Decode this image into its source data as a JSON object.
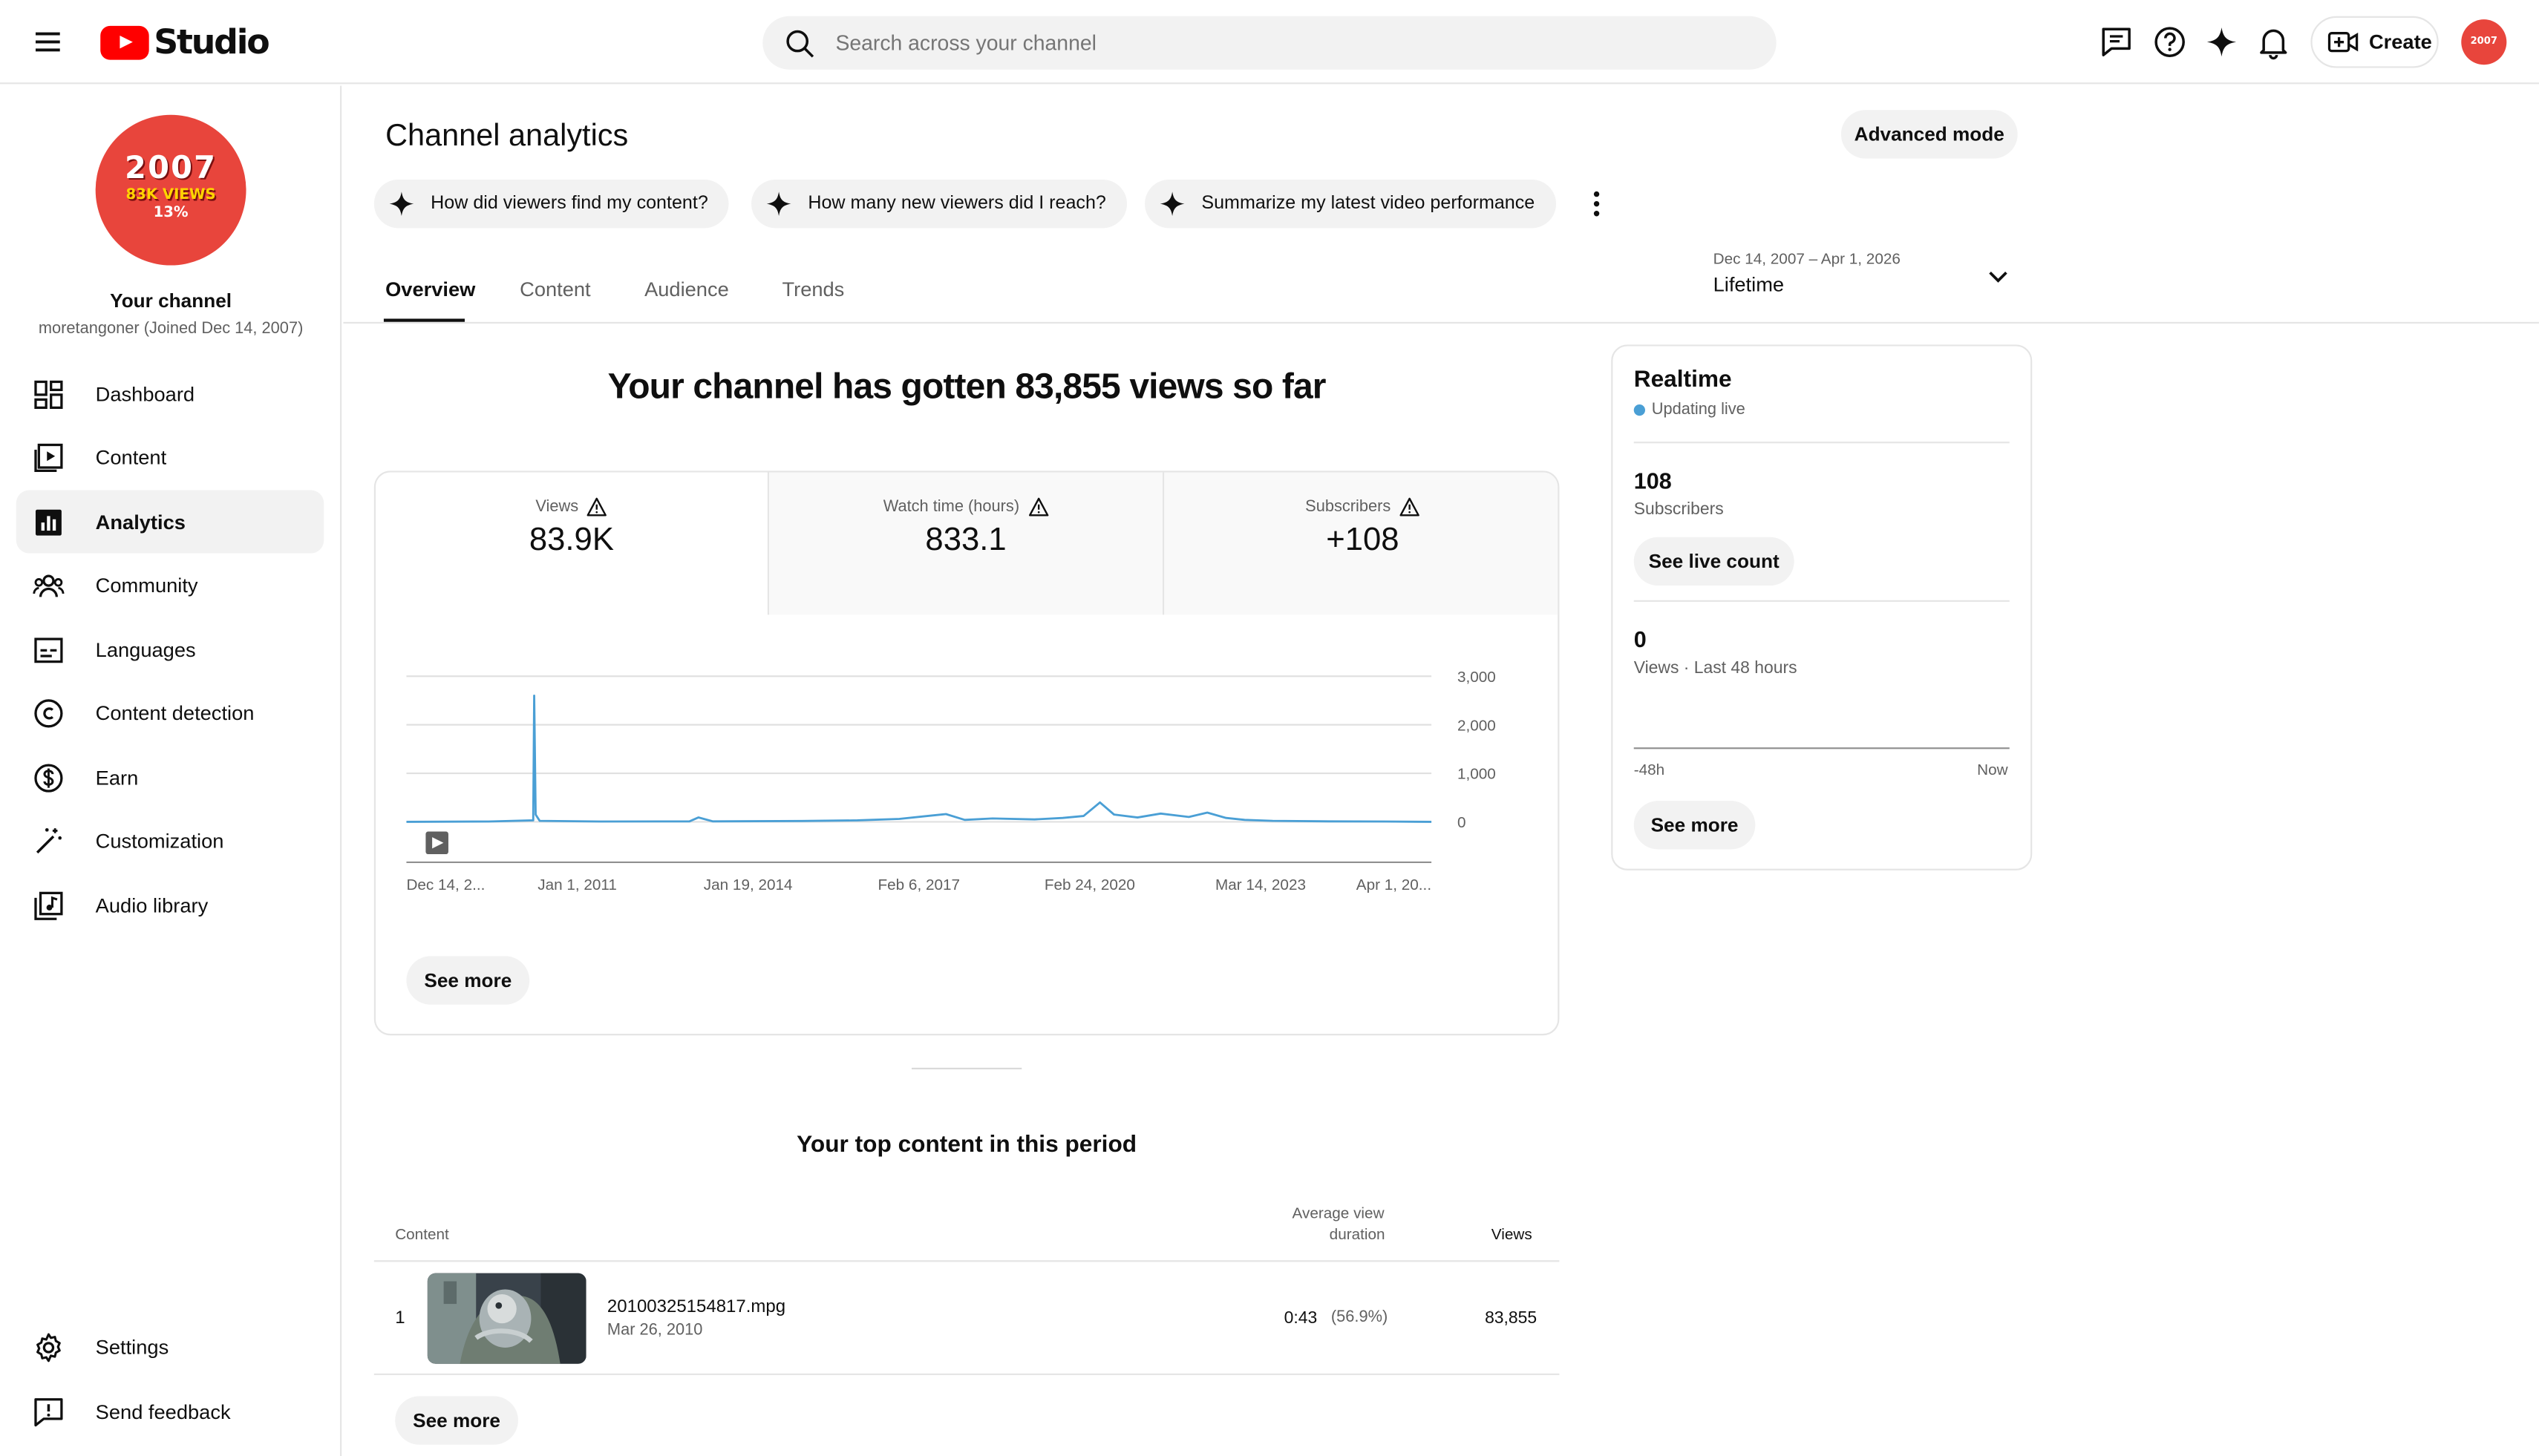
{
  "header": {
    "logo_text": "Studio",
    "search_placeholder": "Search across your channel",
    "create_label": "Create",
    "avatar_text": "2007"
  },
  "sidebar": {
    "avatar": {
      "line1": "2007",
      "line2": "83K VIEWS",
      "line3": "13%"
    },
    "channel_title": "Your channel",
    "channel_handle": "moretangoner (Joined Dec 14, 2007)",
    "items": [
      {
        "label": "Dashboard",
        "icon": "dashboard-icon"
      },
      {
        "label": "Content",
        "icon": "content-icon"
      },
      {
        "label": "Analytics",
        "icon": "analytics-icon",
        "active": true
      },
      {
        "label": "Community",
        "icon": "community-icon"
      },
      {
        "label": "Languages",
        "icon": "subtitles-icon"
      },
      {
        "label": "Content detection",
        "icon": "copyright-icon"
      },
      {
        "label": "Earn",
        "icon": "dollar-icon"
      },
      {
        "label": "Customization",
        "icon": "magic-wand-icon"
      },
      {
        "label": "Audio library",
        "icon": "audio-library-icon"
      }
    ],
    "bottom_items": [
      {
        "label": "Settings",
        "icon": "gear-icon"
      },
      {
        "label": "Send feedback",
        "icon": "feedback-icon"
      }
    ]
  },
  "main": {
    "title": "Channel analytics",
    "advanced_mode": "Advanced mode",
    "chips": [
      "How did viewers find my content?",
      "How many new viewers did I reach?",
      "Summarize my latest video performance"
    ],
    "tabs": [
      "Overview",
      "Content",
      "Audience",
      "Trends"
    ],
    "active_tab": "Overview",
    "date_range": "Dec 14, 2007 – Apr 1, 2026",
    "date_label": "Lifetime",
    "headline": "Your channel has gotten 83,855 views so far",
    "metrics": [
      {
        "label": "Views",
        "value": "83.9K"
      },
      {
        "label": "Watch time (hours)",
        "value": "833.1"
      },
      {
        "label": "Subscribers",
        "value": "+108"
      }
    ],
    "see_more": "See more",
    "top_content_title": "Your top content in this period",
    "table": {
      "headers": {
        "content": "Content",
        "avg_view_duration_1": "Average view",
        "avg_view_duration_2": "duration",
        "views": "Views"
      },
      "rows": [
        {
          "rank": "1",
          "title": "20100325154817.mpg",
          "date": "Mar 26, 2010",
          "avg_duration": "0:43",
          "avg_pct": "(56.9%)",
          "views": "83,855"
        }
      ]
    }
  },
  "realtime": {
    "title": "Realtime",
    "status": "Updating live",
    "subscribers_value": "108",
    "subscribers_label": "Subscribers",
    "see_live_count": "See live count",
    "views_value": "0",
    "views_label": "Views · Last 48 hours",
    "axis_start": "-48h",
    "axis_end": "Now",
    "see_more": "See more"
  },
  "chart_data": {
    "type": "line",
    "title": "",
    "xlabel": "",
    "ylabel": "",
    "x_tick_labels": [
      "Dec 14, 2...",
      "Jan 1, 2011",
      "Jan 19, 2014",
      "Feb 6, 2017",
      "Feb 24, 2020",
      "Mar 14, 2023",
      "Apr 1, 20..."
    ],
    "y_tick_labels": [
      "3,000",
      "2,000",
      "1,000",
      "0"
    ],
    "ylim": [
      0,
      3000
    ],
    "series": [
      {
        "color": "#4a9fd5",
        "points": [
          [
            "2007-12-14",
            0
          ],
          [
            "2009-06-01",
            5
          ],
          [
            "2010-03-20",
            30
          ],
          [
            "2010-03-26",
            2600
          ],
          [
            "2010-04-05",
            150
          ],
          [
            "2010-05-01",
            20
          ],
          [
            "2011-06-01",
            5
          ],
          [
            "2013-01-01",
            10
          ],
          [
            "2013-03-01",
            90
          ],
          [
            "2013-06-01",
            10
          ],
          [
            "2015-01-01",
            15
          ],
          [
            "2016-01-01",
            30
          ],
          [
            "2016-10-01",
            60
          ],
          [
            "2017-04-01",
            120
          ],
          [
            "2017-08-01",
            160
          ],
          [
            "2017-12-01",
            40
          ],
          [
            "2018-06-01",
            70
          ],
          [
            "2019-03-01",
            50
          ],
          [
            "2019-09-01",
            80
          ],
          [
            "2020-01-15",
            120
          ],
          [
            "2020-05-01",
            400
          ],
          [
            "2020-08-01",
            150
          ],
          [
            "2021-01-01",
            90
          ],
          [
            "2021-06-01",
            170
          ],
          [
            "2021-12-01",
            100
          ],
          [
            "2022-04-01",
            190
          ],
          [
            "2022-08-01",
            80
          ],
          [
            "2022-12-01",
            40
          ],
          [
            "2023-06-01",
            20
          ],
          [
            "2024-06-01",
            10
          ],
          [
            "2025-06-01",
            5
          ],
          [
            "2026-04-01",
            0
          ]
        ]
      }
    ],
    "grid": true,
    "marker_icon": "video-marker-icon",
    "marker_date": "2010-03-26"
  }
}
